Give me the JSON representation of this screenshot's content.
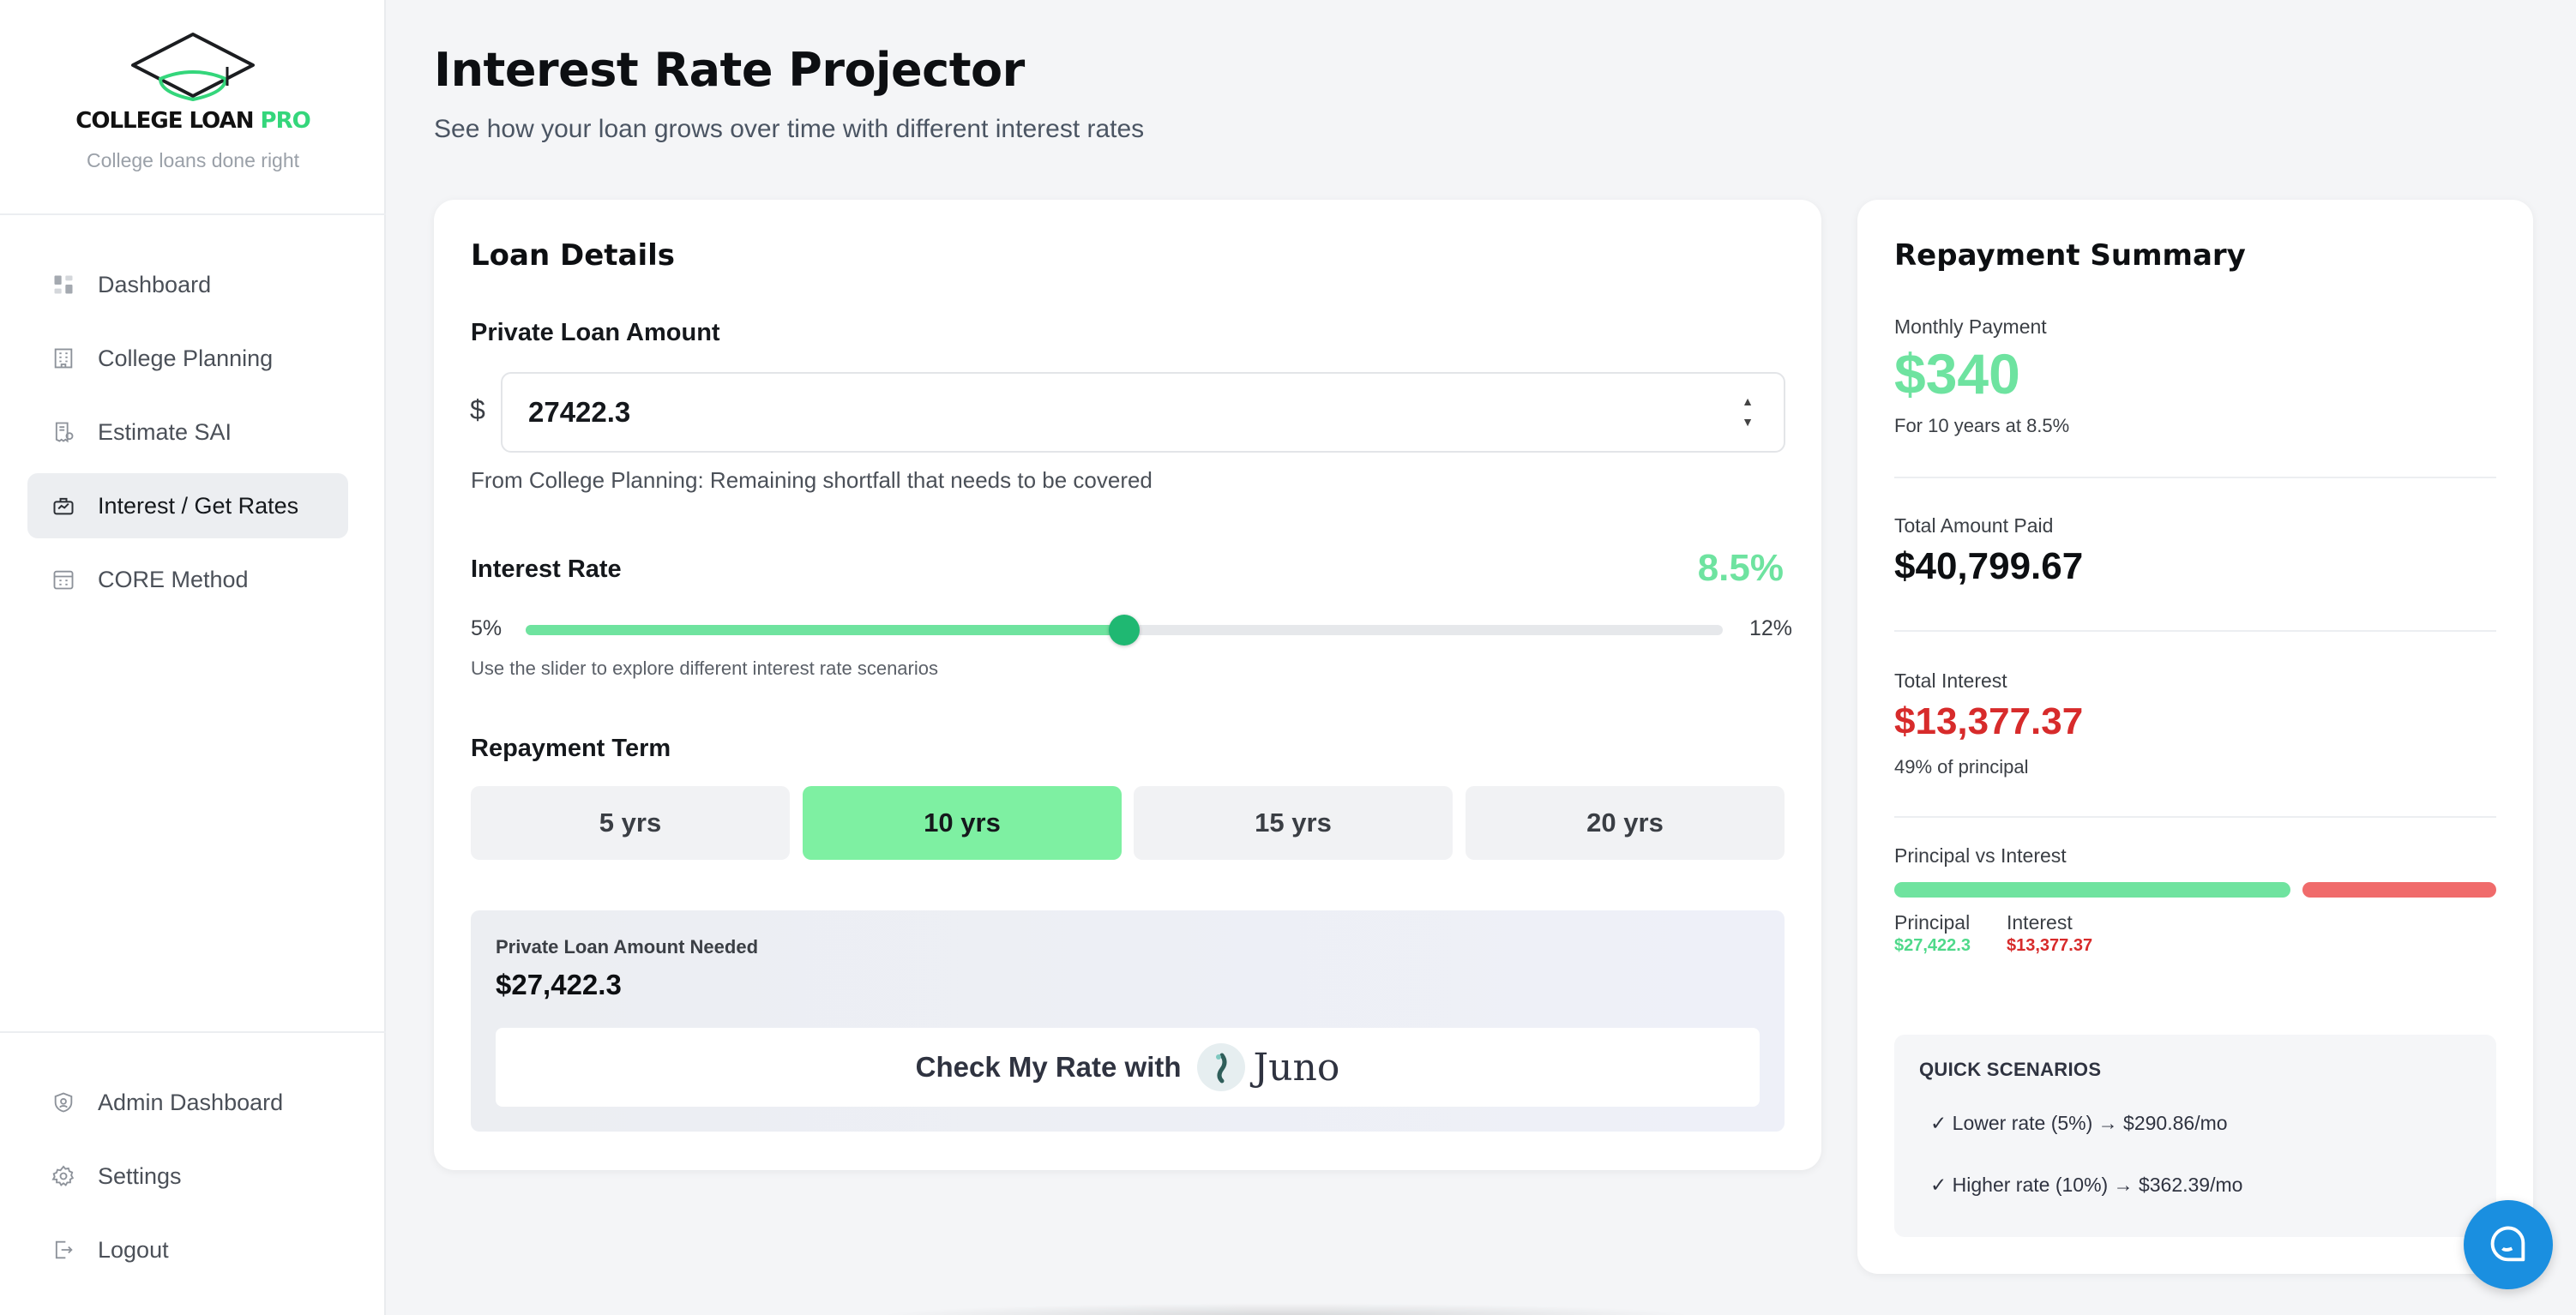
{
  "brand": {
    "name_part1": "COLLEGE LOAN ",
    "name_part2": "PRO",
    "tagline": "College loans done right"
  },
  "nav": {
    "items": [
      {
        "label": "Dashboard",
        "icon": "dashboard-icon"
      },
      {
        "label": "College Planning",
        "icon": "building-icon"
      },
      {
        "label": "Estimate SAI",
        "icon": "calculator-receipt-icon"
      },
      {
        "label": "Interest / Get Rates",
        "icon": "briefcase-rates-icon",
        "active": true
      },
      {
        "label": "CORE Method",
        "icon": "calendar-grid-icon"
      }
    ],
    "bottom_items": [
      {
        "label": "Admin Dashboard",
        "icon": "shield-icon"
      },
      {
        "label": "Settings",
        "icon": "gear-icon"
      },
      {
        "label": "Logout",
        "icon": "logout-icon"
      }
    ]
  },
  "header": {
    "title": "Interest Rate Projector",
    "subtitle": "See how your loan grows over time with different interest rates"
  },
  "loan_details": {
    "title": "Loan Details",
    "amount_label": "Private Loan Amount",
    "currency_symbol": "$",
    "amount_value": "27422.3",
    "amount_hint": "From College Planning: Remaining shortfall that needs to be covered",
    "rate_label": "Interest Rate",
    "rate_value": "8.5%",
    "rate_min_label": "5%",
    "rate_max_label": "12%",
    "rate_min": 5,
    "rate_max": 12,
    "rate_current": 8.5,
    "rate_hint": "Use the slider to explore different interest rate scenarios",
    "term_label": "Repayment Term",
    "terms": [
      "5 yrs",
      "10 yrs",
      "15 yrs",
      "20 yrs"
    ],
    "selected_term": "10 yrs",
    "needed_label": "Private Loan Amount Needed",
    "needed_value": "$27,422.3",
    "cta_text": "Check My Rate with",
    "cta_brand": "Juno"
  },
  "summary": {
    "title": "Repayment Summary",
    "monthly_label": "Monthly Payment",
    "monthly_value": "$340",
    "monthly_note": "For 10 years at 8.5%",
    "total_paid_label": "Total Amount Paid",
    "total_paid_value": "$40,799.67",
    "total_interest_label": "Total Interest",
    "total_interest_value": "$13,377.37",
    "interest_note": "49% of principal",
    "pvi_label": "Principal vs Interest",
    "principal_label": "Principal",
    "principal_value": "$27,422.3",
    "interest_label": "Interest",
    "interest_value": "$13,377.37",
    "principal_amount": 27422.3,
    "interest_amount": 13377.37,
    "quick_title": "QUICK SCENARIOS",
    "scenarios": [
      "✓ Lower rate (5%) → $290.86/mo",
      "✓ Higher rate (10%) → $362.39/mo"
    ]
  },
  "colors": {
    "accent_green": "#6ee3a0",
    "thumb_green": "#1fb872",
    "interest_red": "#d72b2b",
    "chat_blue": "#1a8fe0"
  },
  "chat": {
    "icon": "chat-bubble-icon"
  }
}
